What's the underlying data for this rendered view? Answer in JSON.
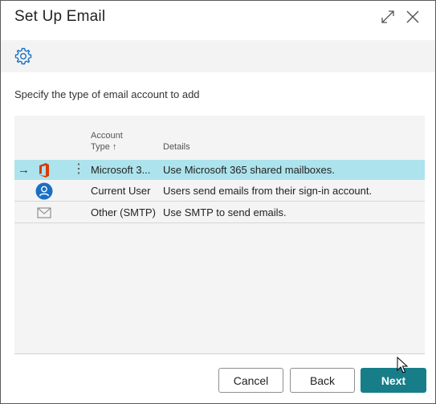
{
  "dialog": {
    "title": "Set Up Email"
  },
  "toolbar": {
    "settings_icon": "gear-icon"
  },
  "instruction": "Specify the type of email account to add",
  "grid": {
    "columns": {
      "account_type_line1": "Account",
      "account_type_line2": "Type ↑",
      "details": "Details"
    },
    "rows": [
      {
        "account_type": "Microsoft 3...",
        "details": "Use Microsoft 365 shared mailboxes.",
        "icon": "office-icon",
        "selected": true
      },
      {
        "account_type": "Current User",
        "details": "Users send emails from their sign-in account.",
        "icon": "user-circle-icon",
        "selected": false
      },
      {
        "account_type": "Other (SMTP)",
        "details": "Use SMTP to send emails.",
        "icon": "envelope-icon",
        "selected": false
      }
    ]
  },
  "buttons": {
    "cancel": "Cancel",
    "back": "Back",
    "next": "Next"
  },
  "colors": {
    "selected_row": "#ade3ec",
    "primary_button": "#177e89",
    "accent_icon": "#1a6fc4",
    "office_red": "#d83b01"
  }
}
